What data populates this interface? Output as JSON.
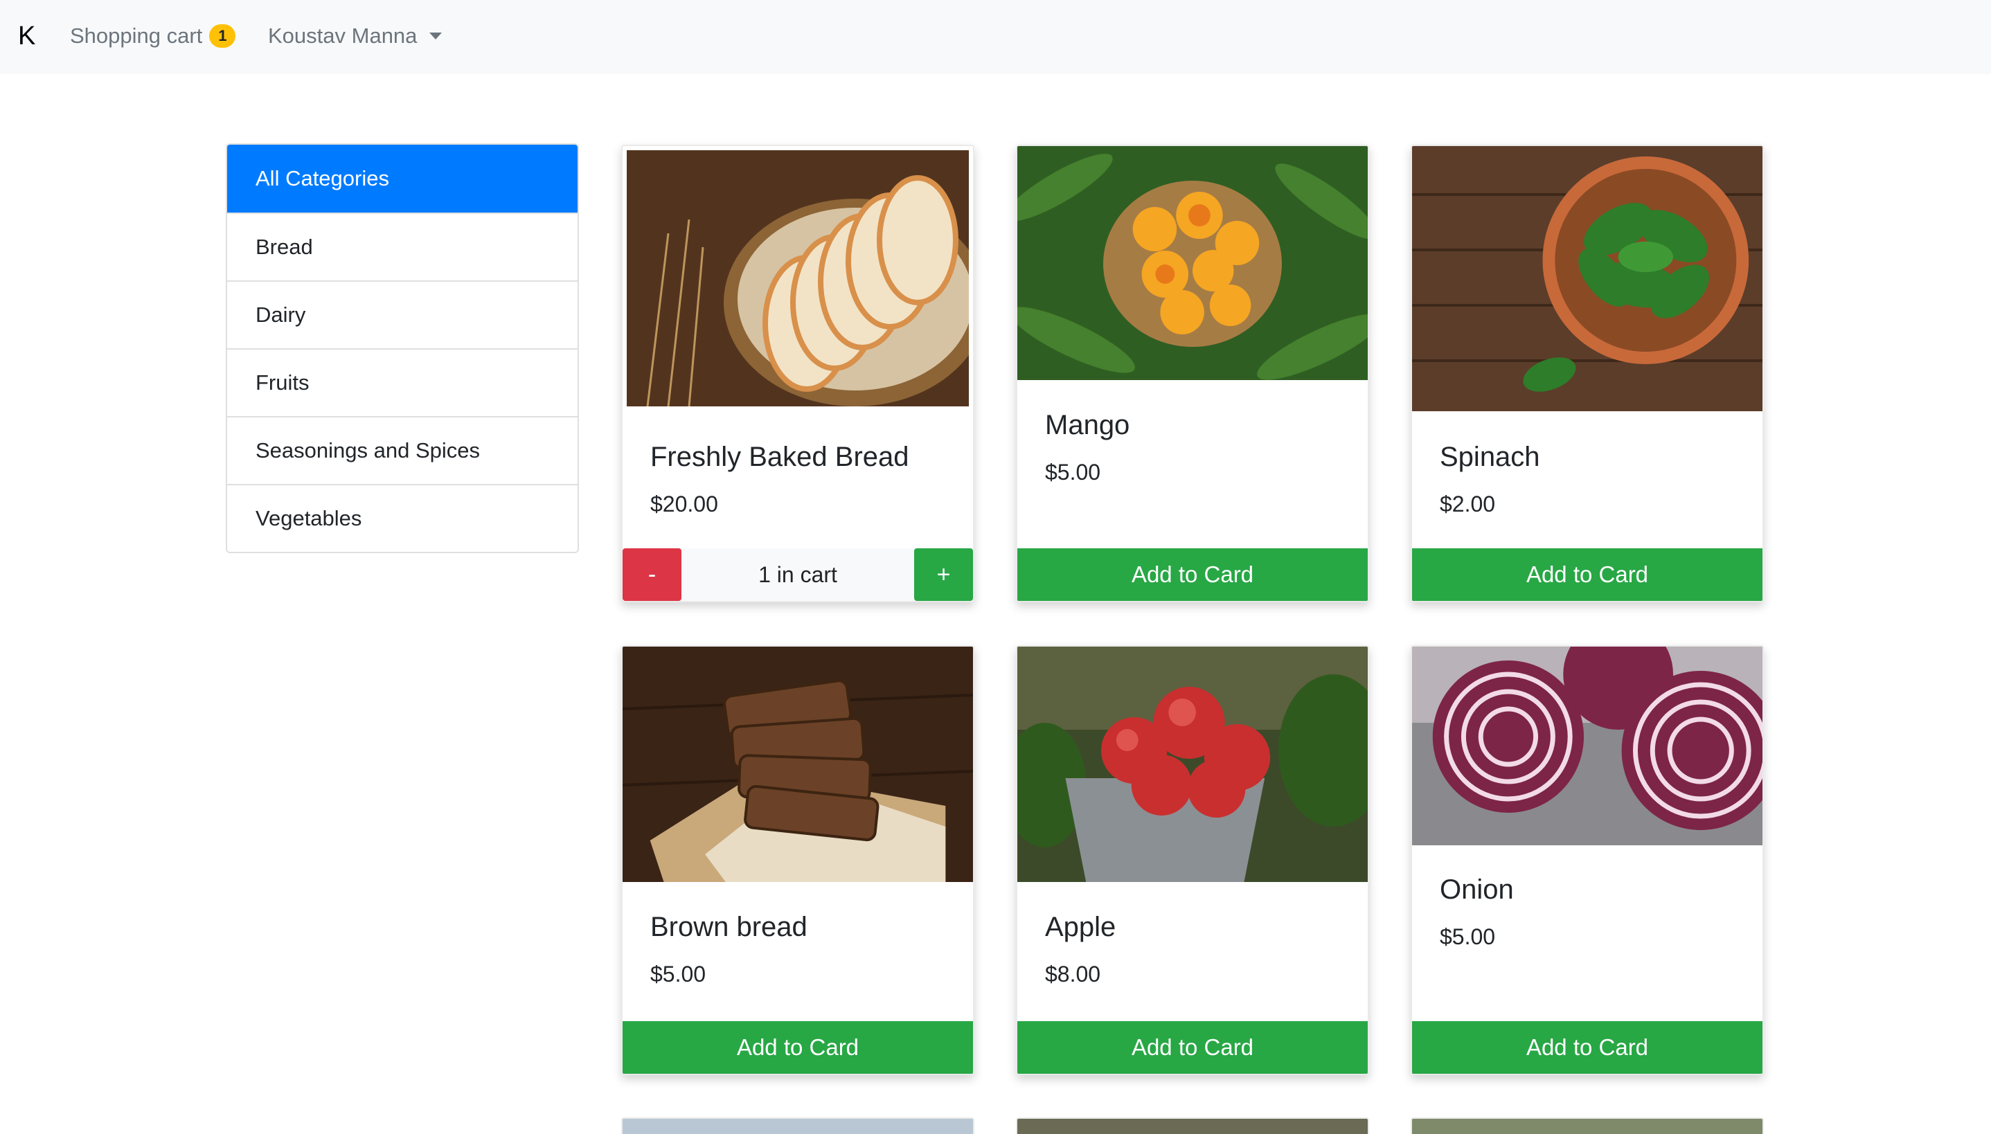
{
  "navbar": {
    "brand": "K",
    "cart_label": "Shopping cart",
    "cart_count": "1",
    "user_name": "Koustav Manna"
  },
  "categories": [
    {
      "label": "All Categories",
      "active": true
    },
    {
      "label": "Bread"
    },
    {
      "label": "Dairy"
    },
    {
      "label": "Fruits"
    },
    {
      "label": "Seasonings and Spices"
    },
    {
      "label": "Vegetables"
    }
  ],
  "products": [
    {
      "name": "Freshly Baked Bread",
      "price": "$20.00",
      "in_cart": "1 in cart",
      "minus": "-",
      "plus": "+",
      "image": "bread-basket-photo"
    },
    {
      "name": "Mango",
      "price": "$5.00",
      "button": "Add to Card",
      "image": "mango-basket-photo"
    },
    {
      "name": "Spinach",
      "price": "$2.00",
      "button": "Add to Card",
      "image": "spinach-bowl-photo"
    },
    {
      "name": "Brown bread",
      "price": "$5.00",
      "button": "Add to Card",
      "image": "brown-bread-photo"
    },
    {
      "name": "Apple",
      "price": "$8.00",
      "button": "Add to Card",
      "image": "apple-bucket-photo"
    },
    {
      "name": "Onion",
      "price": "$5.00",
      "button": "Add to Card",
      "image": "red-onion-photo"
    }
  ],
  "colors": {
    "primary": "#007bff",
    "success": "#28a745",
    "danger": "#dc3545",
    "warning": "#ffc107",
    "navbar_bg": "#f8f9fa"
  }
}
